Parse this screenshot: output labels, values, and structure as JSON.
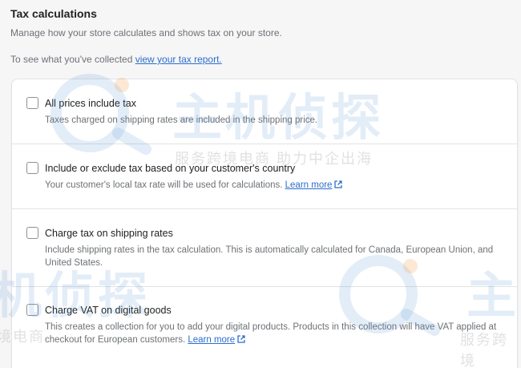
{
  "section": {
    "title": "Tax calculations",
    "description": "Manage how your store calculates and shows tax on your store.",
    "report_prefix": "To see what you've collected ",
    "report_link": "view your tax report."
  },
  "options": [
    {
      "label": "All prices include tax",
      "help": "Taxes charged on shipping rates are included in the shipping price.",
      "checked": false
    },
    {
      "label": "Include or exclude tax based on your customer's country",
      "help": "Your customer's local tax rate will be used for calculations. ",
      "learn_more": "Learn more",
      "checked": false
    },
    {
      "label": "Charge tax on shipping rates",
      "help": "Include shipping rates in the tax calculation. This is automatically calculated for Canada, European Union, and United States.",
      "checked": false
    },
    {
      "label": "Charge VAT on digital goods",
      "help": "This creates a collection for you to add your digital products. Products in this collection will have VAT applied at checkout for European customers. ",
      "learn_more": "Learn more",
      "checked": false
    }
  ],
  "watermark": {
    "brand": "主机侦探",
    "slogan": "服务跨境电商 助力中企出海",
    "brand_partial": "机侦探",
    "slogan_partial_left": "境电商",
    "slogan_partial_right": "服务跨境",
    "brand_partial_right": "主"
  },
  "colors": {
    "link": "#2c6ecb",
    "text": "#202223",
    "subdued": "#6d7175",
    "border": "#e1e3e5"
  }
}
